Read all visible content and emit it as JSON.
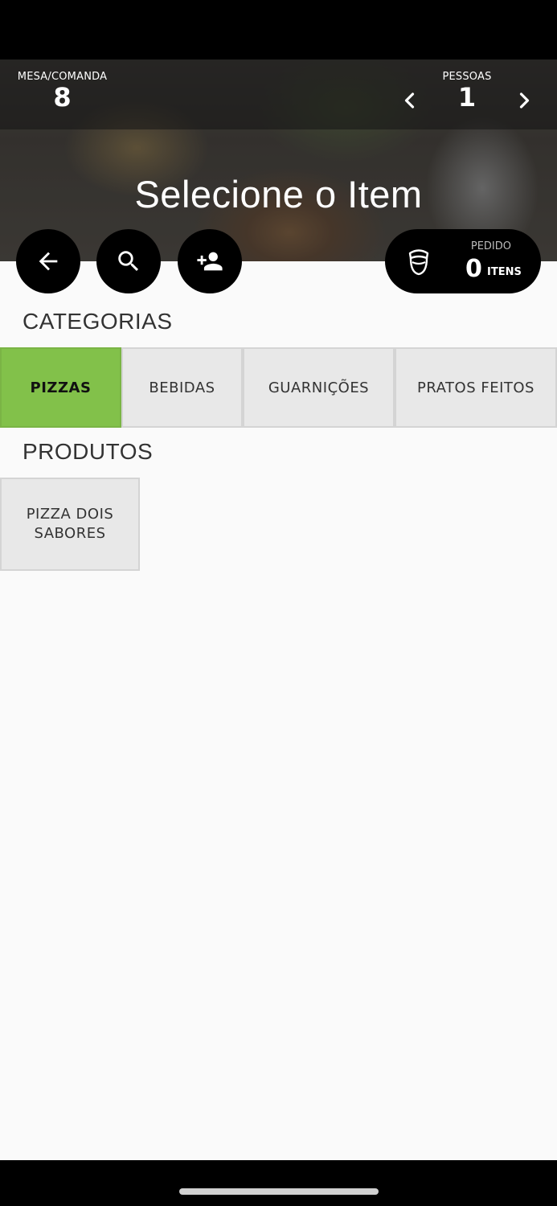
{
  "header": {
    "mesa_label": "MESA/COMANDA",
    "mesa_value": "8",
    "pessoas_label": "PESSOAS",
    "pessoas_value": "1",
    "title": "Selecione o Item"
  },
  "actions": {
    "back_icon": "arrow-left-icon",
    "search_icon": "search-icon",
    "add_person_icon": "person-add-icon",
    "prev_icon": "chevron-left-icon",
    "next_icon": "chevron-right-icon"
  },
  "pedido": {
    "label": "PEDIDO",
    "count": "0",
    "unit": "ITENS",
    "icon": "waiter-icon"
  },
  "categorias": {
    "title": "CATEGORIAS",
    "items": [
      {
        "label": "PIZZAS",
        "active": true
      },
      {
        "label": "BEBIDAS",
        "active": false
      },
      {
        "label": "GUARNIÇÕES",
        "active": false
      },
      {
        "label": "PRATOS FEITOS",
        "active": false
      }
    ]
  },
  "produtos": {
    "title": "PRODUTOS",
    "items": [
      {
        "label": "PIZZA DOIS SABORES"
      }
    ]
  },
  "colors": {
    "accent": "#82c14a",
    "tile_bg": "#e8e8e8",
    "button_bg": "#000000"
  }
}
